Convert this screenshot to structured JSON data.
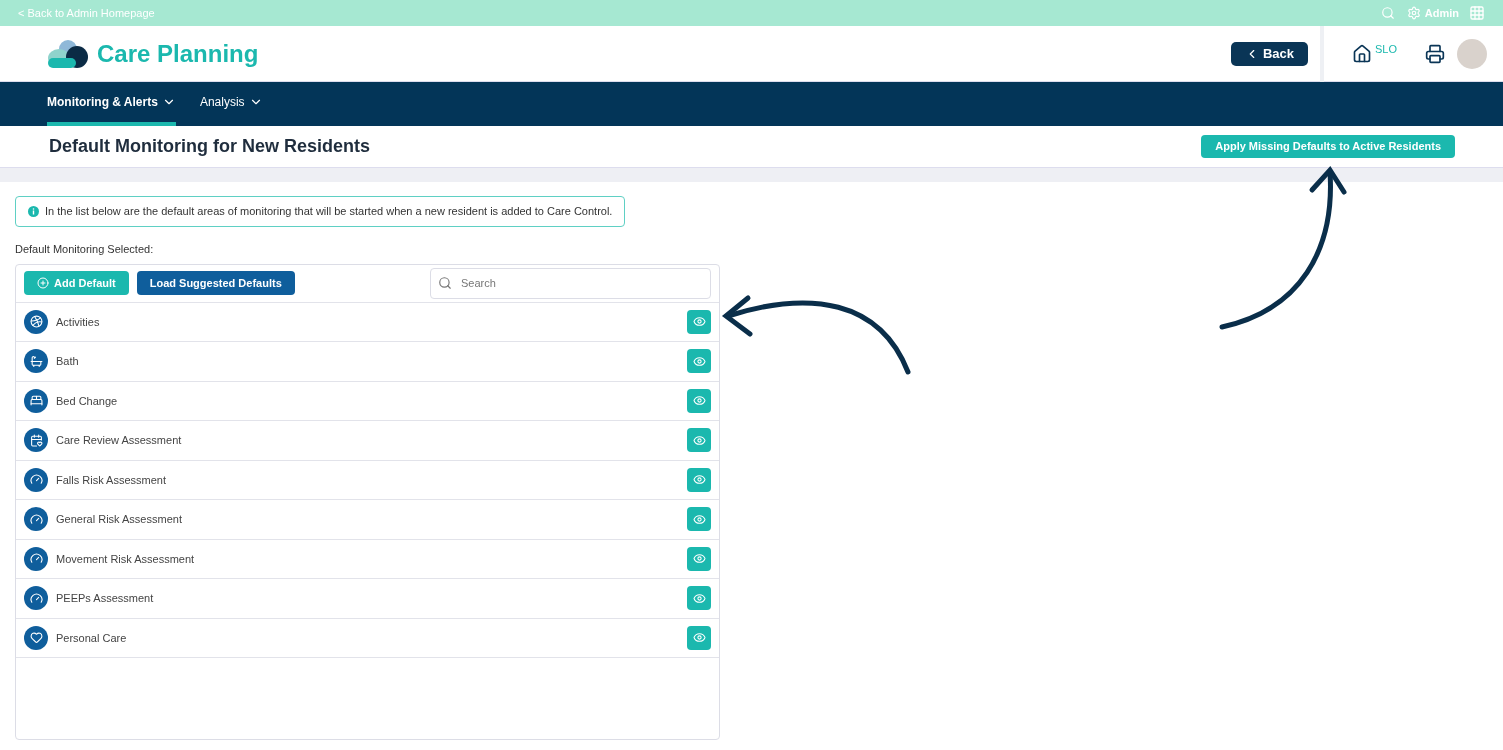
{
  "top_bar": {
    "back_link": "< Back to Admin Homepage",
    "user": "Admin"
  },
  "header": {
    "app_title": "Care Planning",
    "back_button": "Back",
    "home_label": "SLO"
  },
  "nav": [
    {
      "label": "Monitoring & Alerts",
      "selected": true
    },
    {
      "label": "Analysis",
      "selected": false
    }
  ],
  "page": {
    "title": "Default Monitoring for New Residents",
    "apply_button": "Apply Missing Defaults to Active Residents"
  },
  "info": "In the list below are the default areas of monitoring that will be started when a new resident is added to Care Control.",
  "section_label": "Default Monitoring Selected:",
  "toolbar": {
    "add_button": "Add Default",
    "load_button": "Load Suggested Defaults",
    "search": {
      "placeholder": "Search"
    }
  },
  "items": [
    {
      "label": "Activities",
      "kind": "activity"
    },
    {
      "label": "Bath",
      "kind": "bath"
    },
    {
      "label": "Bed Change",
      "kind": "bed"
    },
    {
      "label": "Care Review Assessment",
      "kind": "review"
    },
    {
      "label": "Falls Risk Assessment",
      "kind": "risk"
    },
    {
      "label": "General Risk Assessment",
      "kind": "risk"
    },
    {
      "label": "Movement Risk Assessment",
      "kind": "risk"
    },
    {
      "label": "PEEPs Assessment",
      "kind": "risk"
    },
    {
      "label": "Personal Care",
      "kind": "care"
    }
  ]
}
